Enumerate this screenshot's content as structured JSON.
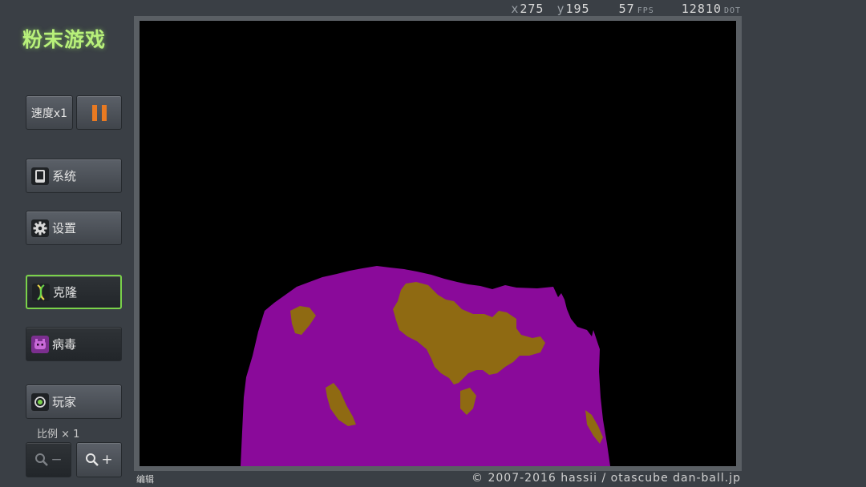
{
  "app": {
    "title": "粉末游戏"
  },
  "toolbar": {
    "speed_label": "速度x1",
    "pause_icon": "pause-icon",
    "system_label": "系统",
    "settings_label": "设置",
    "clone_label": "克隆",
    "virus_label": "病毒",
    "player_label": "玩家"
  },
  "zoom": {
    "label": "比例 × 1",
    "out_symbol": "−",
    "in_symbol": "+"
  },
  "status": {
    "x_prefix": "x",
    "x_value": "275",
    "y_prefix": "y",
    "y_value": "195",
    "fps_value": "57",
    "fps_unit": "FPS",
    "dot_value": "12810",
    "dot_unit": "DOT"
  },
  "footer": {
    "edit_label": "编辑",
    "copyright": "© 2007-2016 hassii / otascube   dan-ball.jp"
  },
  "colors": {
    "accent": "#b8f07a",
    "pause": "#e97a22",
    "powder_purple": "#8a0a9a",
    "powder_gold": "#8f6a12",
    "active_border": "#7ad24a"
  }
}
